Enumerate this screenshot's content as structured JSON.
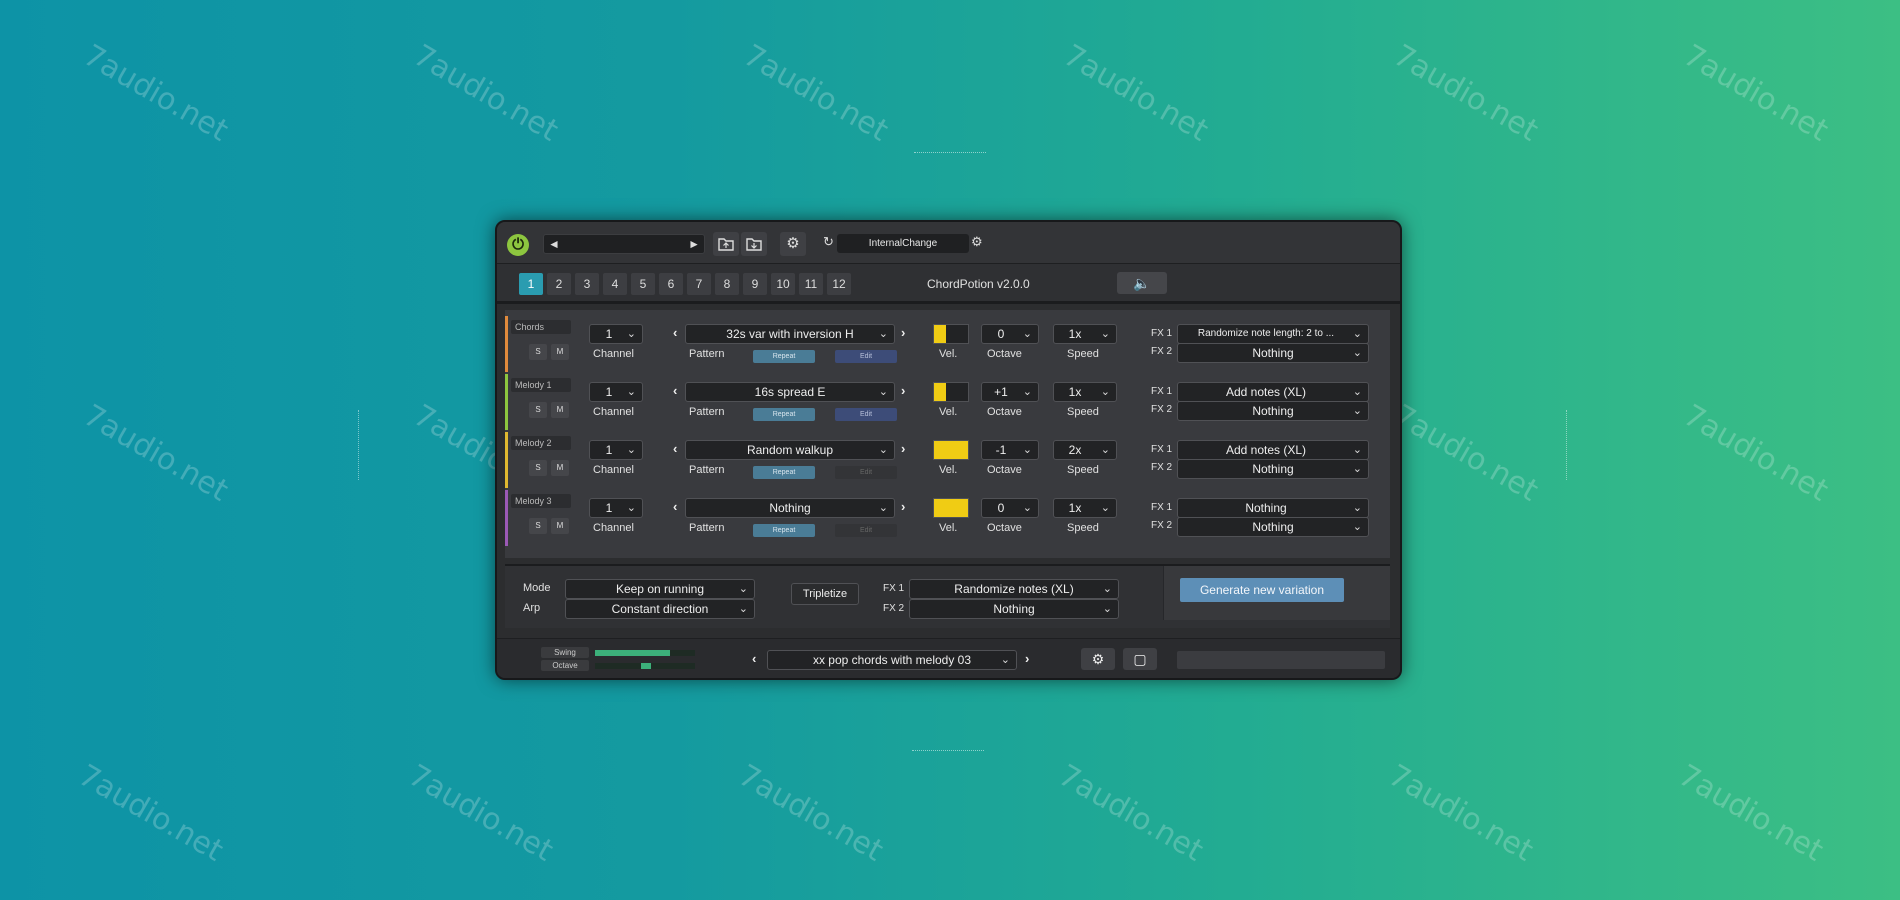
{
  "watermark": "7audio.net",
  "toolbar": {
    "power_icon": "power-icon",
    "prev_arrow": "◄",
    "next_arrow": "►",
    "host_mode": "InternalChange"
  },
  "tabs": [
    "1",
    "2",
    "3",
    "4",
    "5",
    "6",
    "7",
    "8",
    "9",
    "10",
    "11",
    "12"
  ],
  "active_tab": "1",
  "app_title": "ChordPotion v2.0.0",
  "labels": {
    "channel": "Channel",
    "pattern": "Pattern",
    "vel": "Vel.",
    "octave": "Octave",
    "speed": "Speed",
    "repeat": "Repeat",
    "edit": "Edit",
    "fx1": "FX 1",
    "fx2": "FX 2",
    "solo": "S",
    "mute": "M"
  },
  "tracks": [
    {
      "name": "Chords",
      "color": "#e08a3c",
      "channel": "1",
      "pattern": "32s var with inversion H",
      "vel_fill": 0.35,
      "octave": "0",
      "speed": "1x",
      "fx1": "Randomize note length: 2 to ...",
      "fx2": "Nothing",
      "edit_active": true
    },
    {
      "name": "Melody 1",
      "color": "#8dc63f",
      "channel": "1",
      "pattern": "16s spread E",
      "vel_fill": 0.35,
      "octave": "+1",
      "speed": "1x",
      "fx1": "Add notes (XL)",
      "fx2": "Nothing",
      "edit_active": true
    },
    {
      "name": "Melody 2",
      "color": "#e0b830",
      "channel": "1",
      "pattern": "Random walkup",
      "vel_fill": 1.0,
      "octave": "-1",
      "speed": "2x",
      "fx1": "Add notes (XL)",
      "fx2": "Nothing",
      "edit_active": false
    },
    {
      "name": "Melody 3",
      "color": "#9b59b6",
      "channel": "1",
      "pattern": "Nothing",
      "vel_fill": 1.0,
      "octave": "0",
      "speed": "1x",
      "fx1": "Nothing",
      "fx2": "Nothing",
      "edit_active": false
    }
  ],
  "global": {
    "mode_label": "Mode",
    "mode_value": "Keep on running",
    "arp_label": "Arp",
    "arp_value": "Constant direction",
    "tripletize": "Tripletize",
    "fx1_value": "Randomize notes (XL)",
    "fx2_value": "Nothing",
    "generate": "Generate new variation"
  },
  "footer": {
    "swing": "Swing",
    "octave": "Octave",
    "swing_level": 0.75,
    "preset": "xx pop chords with melody 03"
  }
}
